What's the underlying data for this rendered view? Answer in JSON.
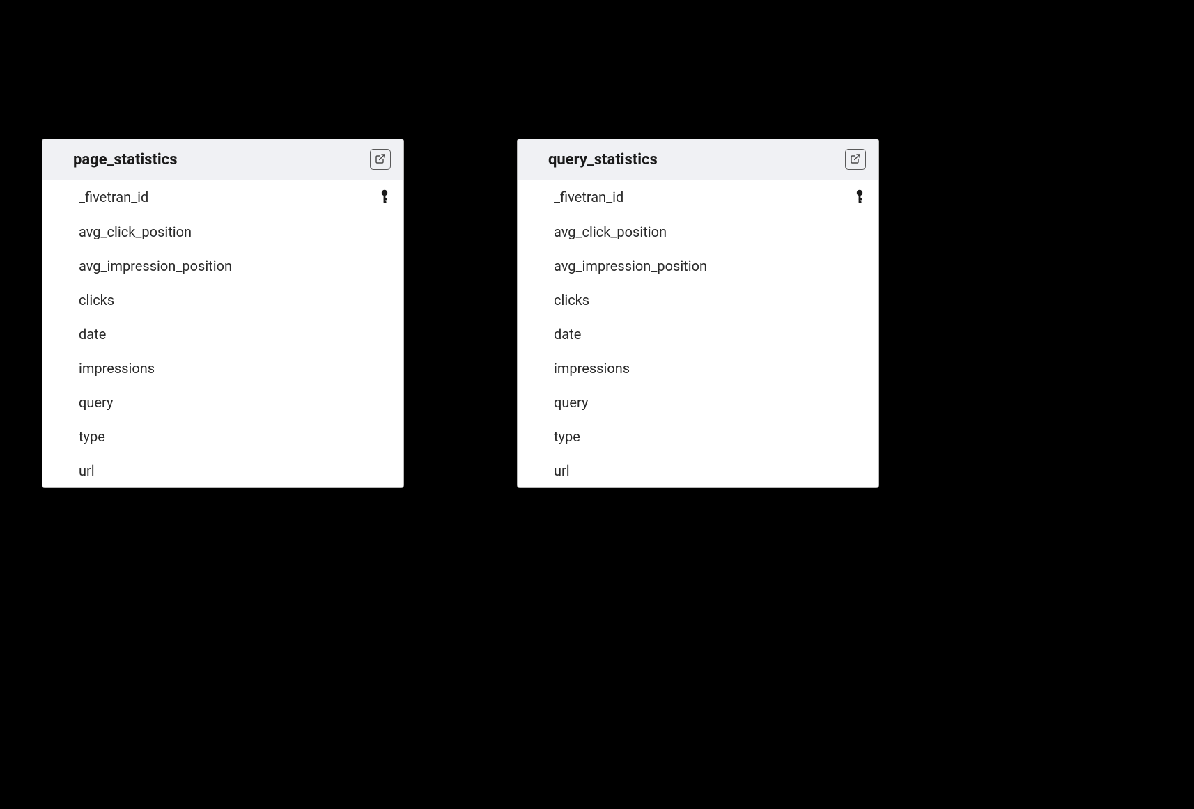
{
  "tables": [
    {
      "name": "page_statistics",
      "columns": [
        {
          "name": "_fivetran_id",
          "pk": true
        },
        {
          "name": "avg_click_position",
          "pk": false
        },
        {
          "name": "avg_impression_position",
          "pk": false
        },
        {
          "name": "clicks",
          "pk": false
        },
        {
          "name": "date",
          "pk": false
        },
        {
          "name": "impressions",
          "pk": false
        },
        {
          "name": "query",
          "pk": false
        },
        {
          "name": "type",
          "pk": false
        },
        {
          "name": "url",
          "pk": false
        }
      ]
    },
    {
      "name": "query_statistics",
      "columns": [
        {
          "name": "_fivetran_id",
          "pk": true
        },
        {
          "name": "avg_click_position",
          "pk": false
        },
        {
          "name": "avg_impression_position",
          "pk": false
        },
        {
          "name": "clicks",
          "pk": false
        },
        {
          "name": "date",
          "pk": false
        },
        {
          "name": "impressions",
          "pk": false
        },
        {
          "name": "query",
          "pk": false
        },
        {
          "name": "type",
          "pk": false
        },
        {
          "name": "url",
          "pk": false
        }
      ]
    }
  ]
}
